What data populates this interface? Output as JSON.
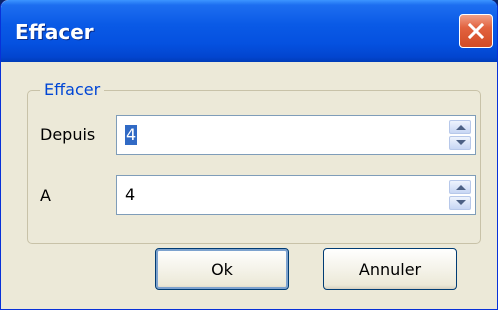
{
  "window": {
    "title": "Effacer",
    "close_icon": "close-icon"
  },
  "group": {
    "legend": "Effacer"
  },
  "fields": {
    "depuis": {
      "label": "Depuis",
      "value": "4"
    },
    "a": {
      "label": "A",
      "value": "4"
    }
  },
  "buttons": {
    "ok": "Ok",
    "cancel": "Annuler"
  },
  "colors": {
    "title_bar": "#0551e0",
    "close_button": "#d24b25",
    "legend_text": "#0046d5",
    "selection": "#316ac5"
  }
}
